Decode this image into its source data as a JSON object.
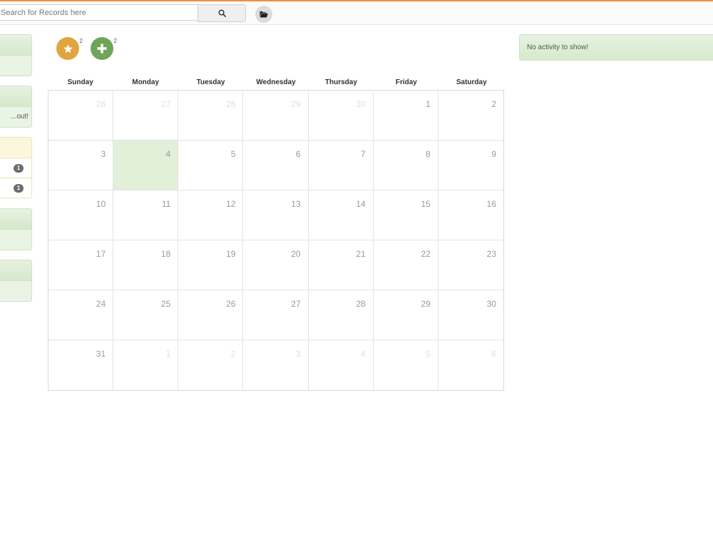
{
  "search": {
    "placeholder": "Search for Records here",
    "icon": "search-icon"
  },
  "folder_button": {
    "icon": "folder-open-icon"
  },
  "sidebar": {
    "panel_text": "...out!",
    "badges": [
      "1",
      "1"
    ]
  },
  "actions": {
    "starred_count": "2",
    "new_count": "2"
  },
  "calendar": {
    "weekdays": [
      "Sunday",
      "Monday",
      "Tuesday",
      "Wednesday",
      "Thursday",
      "Friday",
      "Saturday"
    ],
    "days": [
      {
        "n": "26",
        "other": true
      },
      {
        "n": "27",
        "other": true
      },
      {
        "n": "28",
        "other": true
      },
      {
        "n": "29",
        "other": true
      },
      {
        "n": "30",
        "other": true
      },
      {
        "n": "1"
      },
      {
        "n": "2"
      },
      {
        "n": "3"
      },
      {
        "n": "4",
        "today": true
      },
      {
        "n": "5"
      },
      {
        "n": "6"
      },
      {
        "n": "7"
      },
      {
        "n": "8"
      },
      {
        "n": "9"
      },
      {
        "n": "10"
      },
      {
        "n": "11"
      },
      {
        "n": "12"
      },
      {
        "n": "13"
      },
      {
        "n": "14"
      },
      {
        "n": "15"
      },
      {
        "n": "16"
      },
      {
        "n": "17"
      },
      {
        "n": "18"
      },
      {
        "n": "19"
      },
      {
        "n": "20"
      },
      {
        "n": "21"
      },
      {
        "n": "22"
      },
      {
        "n": "23"
      },
      {
        "n": "24"
      },
      {
        "n": "25"
      },
      {
        "n": "26"
      },
      {
        "n": "27"
      },
      {
        "n": "28"
      },
      {
        "n": "29"
      },
      {
        "n": "30"
      },
      {
        "n": "31"
      },
      {
        "n": "1",
        "other": true
      },
      {
        "n": "2",
        "other": true
      },
      {
        "n": "3",
        "other": true
      },
      {
        "n": "4",
        "other": true
      },
      {
        "n": "5",
        "other": true
      },
      {
        "n": "6",
        "other": true
      }
    ]
  },
  "activity": {
    "empty_text": "No activity to show!"
  },
  "colors": {
    "accent": "#e8904a",
    "star": "#e0a53f",
    "plus": "#6ea557",
    "today": "#e2efd9"
  }
}
